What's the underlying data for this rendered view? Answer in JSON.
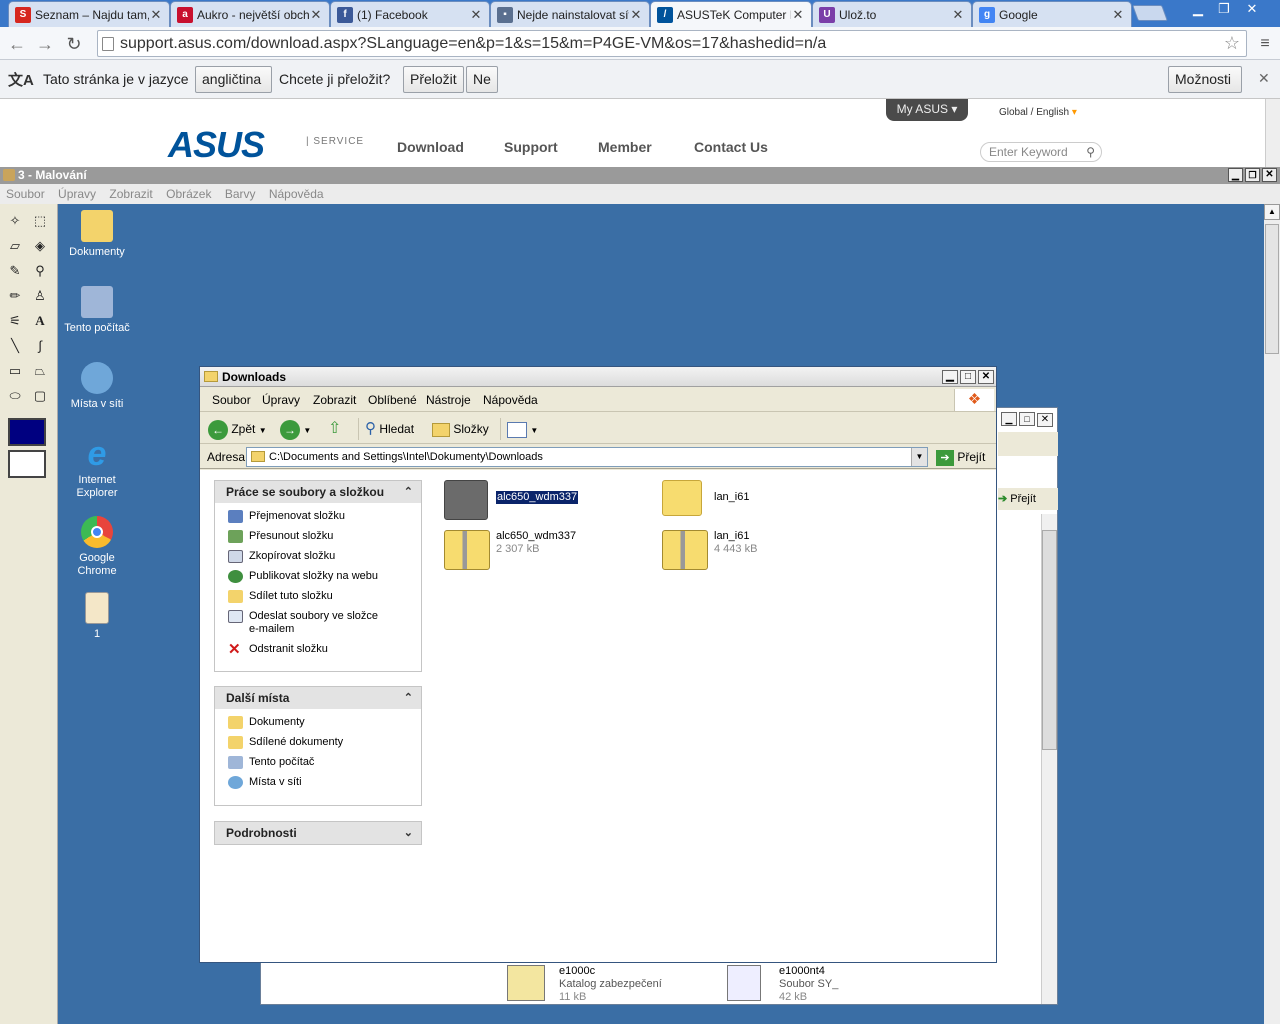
{
  "browser": {
    "tabs": [
      {
        "title": "Seznam – Najdu tam,",
        "favicon": "seznam-icon",
        "color": "#d6271f"
      },
      {
        "title": "Aukro - největší obchc",
        "favicon": "aukro-icon",
        "color": "#c8102e"
      },
      {
        "title": "(1) Facebook",
        "favicon": "facebook-icon",
        "color": "#3b5998"
      },
      {
        "title": "Nejde nainstalovat síť",
        "favicon": "forum-icon",
        "color": "#5a6f8f"
      },
      {
        "title": "ASUSTeK Computer Ir",
        "favicon": "asus-icon",
        "color": "#00539b"
      },
      {
        "title": "Ulož.to",
        "favicon": "ulozto-icon",
        "color": "#7a3ea8"
      },
      {
        "title": "Google",
        "favicon": "google-icon",
        "color": "#4285f4"
      }
    ],
    "url": "support.asus.com/download.aspx?SLanguage=en&p=1&s=15&m=P4GE-VM&os=17&hashedid=n/a"
  },
  "translate_bar": {
    "prefix": "Tato stránka je v jazyce",
    "language": "angličtina",
    "question": "Chcete ji přeložit?",
    "translate_button": "Přeložit",
    "no_button": "Ne",
    "options_button": "Možnosti"
  },
  "asus": {
    "my_asus": "My ASUS",
    "region": "Global / English",
    "logo": "ASUS",
    "service": "| SERVICE",
    "nav": [
      "Download",
      "Support",
      "Member",
      "Contact Us"
    ],
    "search_placeholder": "Enter Keyword"
  },
  "paint": {
    "title": "3 - Malování",
    "menu": [
      "Soubor",
      "Úpravy",
      "Zobrazit",
      "Obrázek",
      "Barvy",
      "Nápověda"
    ]
  },
  "desktop_icons": [
    {
      "label": "Dokumenty",
      "color": "#f3d36b"
    },
    {
      "label": "Tento počítač",
      "color": "#9fb6d8"
    },
    {
      "label": "Místa v síti",
      "color": "#6fa7d9"
    },
    {
      "label": "Internet Explorer",
      "color": "#2f7fd6"
    },
    {
      "label": "Google Chrome",
      "color": "#e8453c"
    },
    {
      "label": "1",
      "color": "#f4e7c8"
    }
  ],
  "explorer": {
    "title": "Downloads",
    "menu": [
      "Soubor",
      "Úpravy",
      "Zobrazit",
      "Oblíbené",
      "Nástroje",
      "Nápověda"
    ],
    "back": "Zpět",
    "search": "Hledat",
    "folders": "Složky",
    "address_label": "Adresa",
    "address": "C:\\Documents and Settings\\Intel\\Dokumenty\\Downloads",
    "go": "Přejít",
    "tasks_title": "Práce se soubory a složkou",
    "tasks": [
      {
        "label": "Přejmenovat složku",
        "icon": "rename-icon"
      },
      {
        "label": "Přesunout složku",
        "icon": "move-icon"
      },
      {
        "label": "Zkopírovat složku",
        "icon": "copy-icon"
      },
      {
        "label": "Publikovat složky na webu",
        "icon": "globe-icon"
      },
      {
        "label": "Sdílet tuto složku",
        "icon": "share-icon"
      },
      {
        "label": "Odeslat soubory ve složce e-mailem",
        "icon": "mail-icon"
      },
      {
        "label": "Odstranit složku",
        "icon": "delete-icon"
      }
    ],
    "places_title": "Další místa",
    "places": [
      {
        "label": "Dokumenty",
        "icon": "documents-icon"
      },
      {
        "label": "Sdílené dokumenty",
        "icon": "shared-folder-icon"
      },
      {
        "label": "Tento počítač",
        "icon": "computer-icon"
      },
      {
        "label": "Místa v síti",
        "icon": "network-icon"
      }
    ],
    "details_title": "Podrobnosti",
    "files": [
      {
        "name": "alc650_wdm337",
        "size": "",
        "type": "folder",
        "selected": true
      },
      {
        "name": "lan_i61",
        "size": "",
        "type": "folder",
        "selected": false
      },
      {
        "name": "alc650_wdm337",
        "size": "2 307 kB",
        "type": "zip",
        "selected": false
      },
      {
        "name": "lan_i61",
        "size": "4 443 kB",
        "type": "zip",
        "selected": false
      }
    ]
  },
  "back_window": {
    "go": "Přejít",
    "files": [
      {
        "name": "e1000c",
        "type": "Katalog zabezpečení",
        "size": "11 kB"
      },
      {
        "name": "e1000nt4",
        "type": "Soubor SY_",
        "size": "42 kB"
      }
    ]
  }
}
